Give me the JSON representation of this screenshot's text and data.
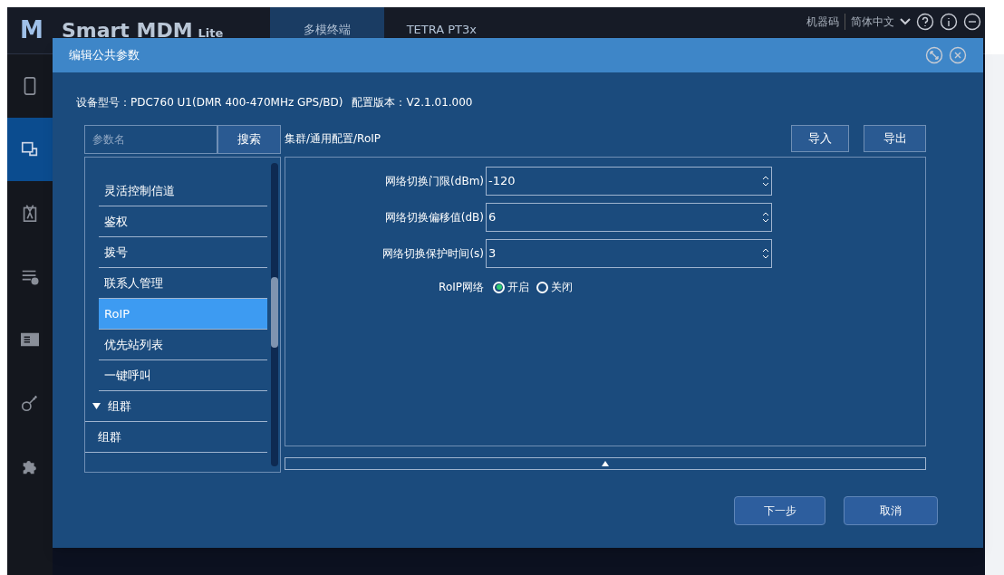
{
  "app": {
    "logo": "M",
    "title": "Smart MDM",
    "edition": "Lite",
    "tabs": [
      {
        "label": "多模终端",
        "selected": true
      },
      {
        "label": "TETRA PT3x",
        "selected": false
      }
    ],
    "machine_code": "机器码",
    "language": "简体中文"
  },
  "sidebar": [
    {
      "selected": false
    },
    {
      "selected": true
    },
    {
      "selected": false
    },
    {
      "selected": false
    },
    {
      "selected": false
    },
    {
      "selected": false
    },
    {
      "selected": false
    }
  ],
  "dialog": {
    "title": "编辑公共参数",
    "device_label": "设备型号：",
    "device": "PDC760 U1(DMR 400-470MHz GPS/BD)",
    "version_label": "配置版本：",
    "version": "V2.1.01.000",
    "search": {
      "placeholder": "参数名",
      "button": "搜索"
    },
    "tree": [
      {
        "kind": "item",
        "label": "灵活控制信道",
        "selected": false
      },
      {
        "kind": "item",
        "label": "鉴权",
        "selected": false
      },
      {
        "kind": "item",
        "label": "拨号",
        "selected": false
      },
      {
        "kind": "item",
        "label": "联系人管理",
        "selected": false
      },
      {
        "kind": "item",
        "label": "RoIP",
        "selected": true
      },
      {
        "kind": "item",
        "label": "优先站列表",
        "selected": false
      },
      {
        "kind": "item",
        "label": "一键呼叫",
        "selected": false
      },
      {
        "kind": "group",
        "label": "组群",
        "expanded": true,
        "children": [
          {
            "kind": "item",
            "label": "组群",
            "selected": false
          }
        ]
      }
    ],
    "breadcrumb": "集群/通用配置/RoIP",
    "import": "导入",
    "export": "导出",
    "fields": [
      {
        "label": "网络切换门限(dBm)",
        "value": "-120"
      },
      {
        "label": "网络切换偏移值(dB)",
        "value": "6"
      },
      {
        "label": "网络切换保护时间(s)",
        "value": "3"
      }
    ],
    "radio": {
      "label": "RoIP网络",
      "options": [
        {
          "label": "开启",
          "selected": true
        },
        {
          "label": "关闭",
          "selected": false
        }
      ]
    },
    "next": "下一步",
    "cancel": "取消"
  }
}
